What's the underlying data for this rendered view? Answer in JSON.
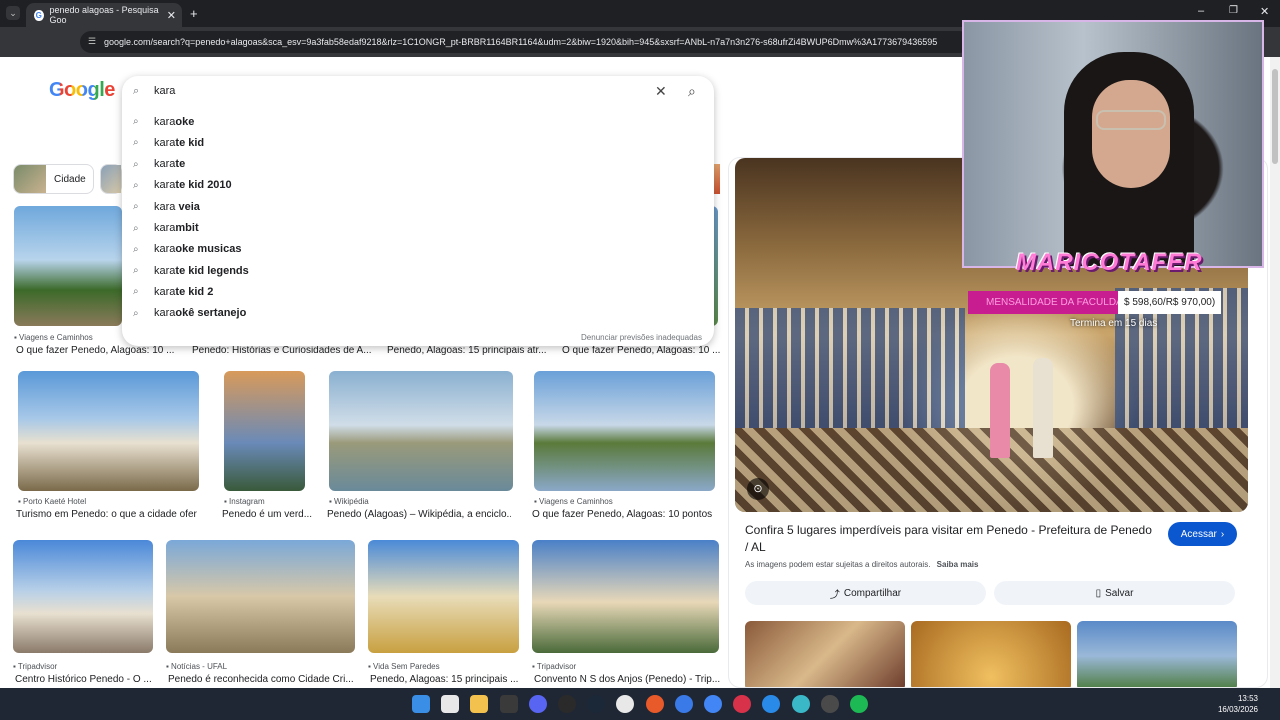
{
  "browser": {
    "tab_title": "penedo alagoas - Pesquisa Goo",
    "url": "google.com/search?q=penedo+alagoas&sca_esv=9a3fab58edaf9218&rlz=1C1ONGR_pt-BRBR1164BR1164&udm=2&biw=1920&bih=945&sxsrf=ANbL-n7a7n3n276-s68ufrZi4BWUP6Dmw%3A1773679436595"
  },
  "logo": "Google",
  "search": {
    "query": "kara",
    "suggestions": [
      {
        "prefix": "kara",
        "rest": "oke"
      },
      {
        "prefix": "kara",
        "rest": "te kid"
      },
      {
        "prefix": "kara",
        "rest": "te"
      },
      {
        "prefix": "kara",
        "rest": "te kid 2010"
      },
      {
        "prefix": "kara ",
        "rest": "veia"
      },
      {
        "prefix": "kara",
        "rest": "mbit"
      },
      {
        "prefix": "kara",
        "rest": "oke musicas"
      },
      {
        "prefix": "kara",
        "rest": "te kid legends"
      },
      {
        "prefix": "kara",
        "rest": "te kid 2"
      },
      {
        "prefix": "kara",
        "rest": "okê sertanejo"
      }
    ],
    "report_link": "Denunciar previsões inadequadas"
  },
  "chips": {
    "cidade": "Cidade"
  },
  "results": {
    "row1": [
      {
        "source": "Viagens e Caminhos",
        "title": "O que fazer Penedo, Alagoas: 10 ..."
      },
      {
        "source": "",
        "title": "Penedo: Histórias e Curiosidades de A..."
      },
      {
        "source": "",
        "title": "Penedo, Alagoas: 15 principais atr..."
      },
      {
        "source": "",
        "title": "O que fazer Penedo, Alagoas: 10 ..."
      }
    ],
    "row2": [
      {
        "source": "Porto Kaeté Hotel",
        "title": "Turismo em Penedo: o que a cidade ofer..."
      },
      {
        "source": "Instagram",
        "title": "Penedo é um verd..."
      },
      {
        "source": "Wikipédia",
        "title": "Penedo (Alagoas) – Wikipédia, a enciclo..."
      },
      {
        "source": "Viagens e Caminhos",
        "title": "O que fazer Penedo, Alagoas: 10 pontos ..."
      }
    ],
    "row3": [
      {
        "source": "Tripadvisor",
        "title": "Centro Histórico Penedo - O ..."
      },
      {
        "source": "Notícias - UFAL",
        "title": "Penedo é reconhecida como Cidade Cri..."
      },
      {
        "source": "Vida Sem Paredes",
        "title": "Penedo, Alagoas: 15 principais ..."
      },
      {
        "source": "Tripadvisor",
        "title": "Convento N S dos Anjos (Penedo) - Trip..."
      }
    ]
  },
  "panel": {
    "title": "Confira 5 lugares imperdíveis para visitar em Penedo - Prefeitura de Penedo / AL",
    "visit_button": "Acessar",
    "copyright": "As imagens podem estar sujeitas a direitos autorais.",
    "learn_more": "Saiba mais",
    "share": "Compartilhar",
    "save": "Salvar"
  },
  "overlay": {
    "brand": "MARICOTAFER",
    "bar_left": "MENSALIDADE DA FACULDADE (R",
    "bar_right": "$ 598,60/R$ 970,00)",
    "subtitle": "Termina em 15 dias"
  },
  "clock": {
    "time": "13:53",
    "date": "16/03/2026"
  },
  "colors": {
    "accent": "#0b57d0",
    "chrome_dark": "#1f2023",
    "toolbar": "#35363a",
    "overlay_pink": "#c81d90"
  }
}
